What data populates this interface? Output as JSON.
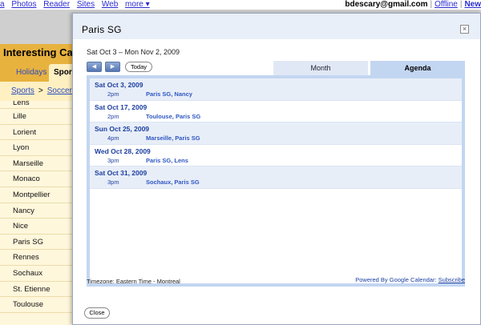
{
  "google_bar": {
    "links": [
      "a",
      "Photos",
      "Reader",
      "Sites",
      "Web",
      "more ▾"
    ],
    "email": "bdescary@gmail.com",
    "sep1": "|",
    "offline": "Offline",
    "sep2": "|",
    "new": "New"
  },
  "background": {
    "header": "Interesting Cale",
    "tabs": [
      "Holidays",
      "Sport"
    ],
    "breadcrumb": [
      "Sports",
      ">",
      "Soccer"
    ],
    "teams_partial": "Lens",
    "teams": [
      "Lille",
      "Lorient",
      "Lyon",
      "Marseille",
      "Monaco",
      "Montpellier",
      "Nancy",
      "Nice",
      "Paris SG",
      "Rennes",
      "Sochaux",
      "St. Etienne",
      "Toulouse"
    ]
  },
  "modal": {
    "title": "Paris SG",
    "close_x": "×",
    "date_range": "Sat Oct 3 – Mon Nov 2, 2009",
    "prev_arrow": "◀",
    "next_arrow": "▶",
    "today_label": "Today",
    "tabs": {
      "month": "Month",
      "agenda": "Agenda"
    },
    "agenda": [
      {
        "date": "Sat Oct 3, 2009",
        "time": "2pm",
        "title": "Paris SG, Nancy"
      },
      {
        "date": "Sat Oct 17, 2009",
        "time": "2pm",
        "title": "Toulouse, Paris SG"
      },
      {
        "date": "Sun Oct 25, 2009",
        "time": "4pm",
        "title": "Marseille, Paris SG"
      },
      {
        "date": "Wed Oct 28, 2009",
        "time": "3pm",
        "title": "Paris SG, Lens"
      },
      {
        "date": "Sat Oct 31, 2009",
        "time": "3pm",
        "title": "Sochaux, Paris SG"
      }
    ],
    "timezone": "Timezone: Eastern Time - Montreal",
    "powered_by": "Powered By Google Calendar:",
    "subscribe": "Subscribe",
    "close_label": "Close"
  }
}
